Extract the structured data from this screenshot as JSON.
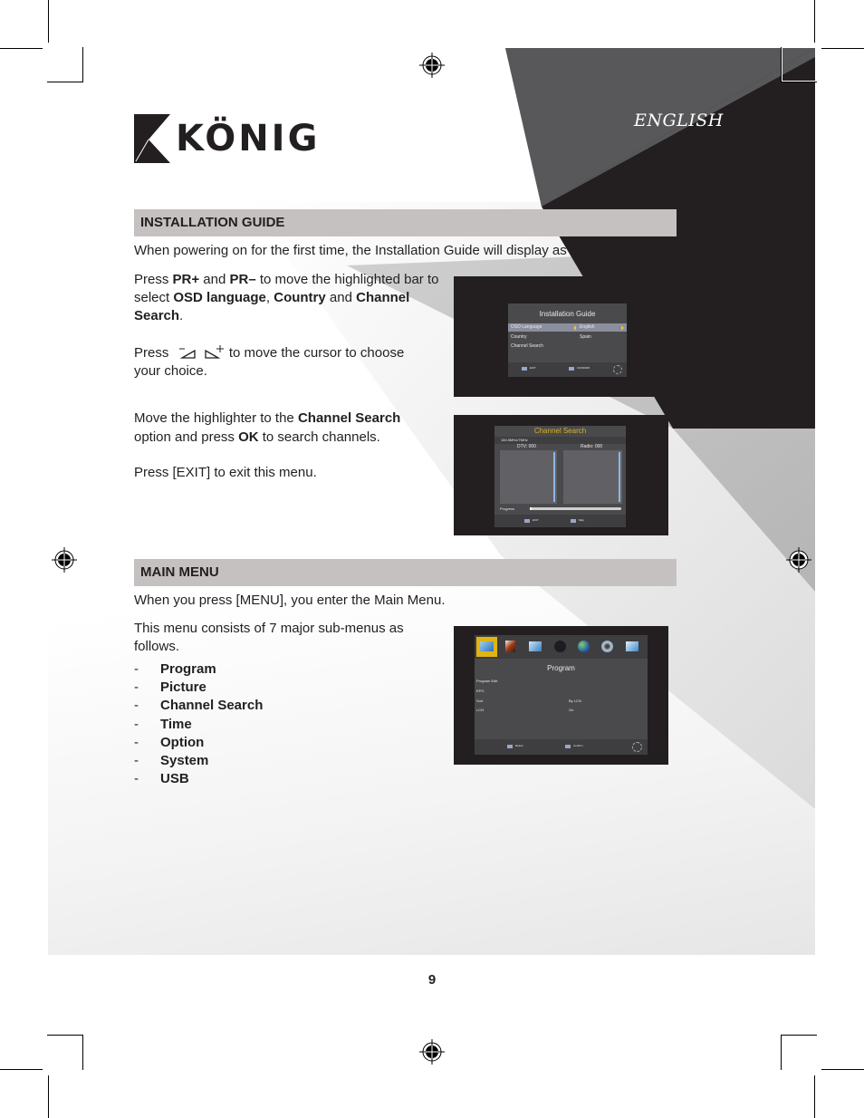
{
  "header": {
    "brand": "KÖNIG",
    "language_label": "ENGLISH"
  },
  "sections": {
    "installation_guide": {
      "title": "INSTALLATION GUIDE",
      "intro": "When powering on for the first time, the Installation Guide will display as below.",
      "para1": {
        "t1": "Press ",
        "b1": "PR+",
        "t2": " and ",
        "b2": "PR–",
        "t3": " to move the highlighted bar to select ",
        "b3": "OSD language",
        "t4": ", ",
        "b4": "Country",
        "t5": " and ",
        "b5": "Channel Search",
        "t6": "."
      },
      "para2": {
        "t1": "Press",
        "icon_left": "volume-down-icon",
        "icon_right": "volume-up-icon",
        "t2": " to move the cursor to choose your choice."
      },
      "para3": {
        "t1": "Move the highlighter to the ",
        "b1": "Channel Search",
        "t2": " option and press ",
        "b2": "OK",
        "t3": " to search channels."
      },
      "para4": "Press [EXIT] to exit this menu.",
      "screen1": {
        "title": "Installation Guide",
        "rows": [
          {
            "label": "OSD Language",
            "value": "English",
            "highlighted": true
          },
          {
            "label": "Country",
            "value": "Spain",
            "highlighted": false
          },
          {
            "label": "Channel Search",
            "value": "",
            "highlighted": false
          }
        ],
        "footer": [
          {
            "key": "EXIT",
            "label": "EXIT"
          },
          {
            "key": "OK",
            "label": "CONFIRM"
          }
        ]
      },
      "screen2": {
        "title": "Channel Search",
        "frequency": "184.5MHz/7MHz",
        "dtv_label": "DTV: 000",
        "radio_label": "Radio: 000",
        "progress_label": "Progress",
        "progress_fraction": 0.02,
        "footer": [
          {
            "key": "EXIT",
            "label": "EXIT"
          },
          {
            "key": "MENU",
            "label": "Skip"
          }
        ]
      }
    },
    "main_menu": {
      "title": "MAIN MENU",
      "intro": "When you press [MENU], you enter the Main Menu.",
      "para1": "This menu consists of 7 major sub-menus as follows.",
      "items": [
        "Program",
        "Picture",
        "Channel Search",
        "Time",
        "Option",
        "System",
        "USB"
      ],
      "screen3": {
        "icons": [
          "program-icon",
          "picture-icon",
          "channel-search-icon",
          "time-icon",
          "option-icon",
          "system-icon",
          "usb-icon"
        ],
        "selected_index": 0,
        "title": "Program",
        "rows": [
          {
            "label": "Program Edit",
            "value": ""
          },
          {
            "label": "EPG",
            "value": ""
          },
          {
            "label": "Sort",
            "value": "By LCN"
          },
          {
            "label": "LCN",
            "value": "On"
          }
        ],
        "footer": [
          {
            "key": "EXIT",
            "label": "Return"
          },
          {
            "key": "OK",
            "label": "Confirm"
          }
        ]
      }
    }
  },
  "footer": {
    "page_number": "9"
  },
  "colors": {
    "section_bar": "#c6c1c1",
    "dark": "#231f20",
    "mid_gray": "#58585a",
    "osd_highlight": "#f0c419"
  }
}
